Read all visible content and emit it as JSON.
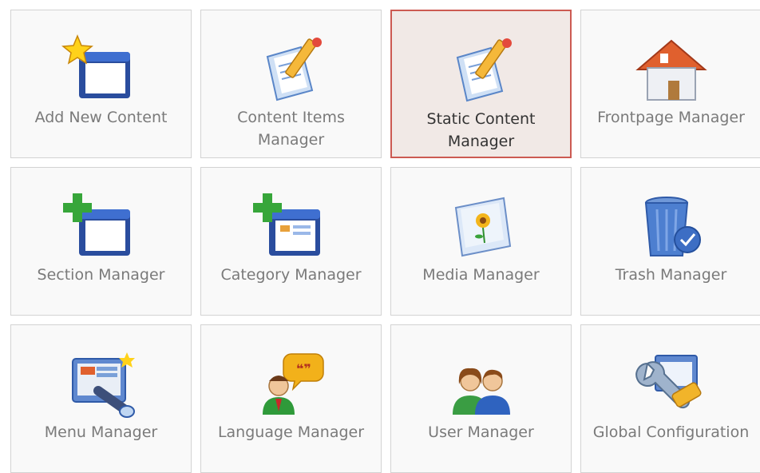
{
  "tiles": [
    {
      "label": "Add New Content",
      "icon": "add-content-icon"
    },
    {
      "label": "Content Items Manager",
      "icon": "content-items-icon"
    },
    {
      "label": "Static Content Manager",
      "icon": "static-content-icon",
      "active": true
    },
    {
      "label": "Frontpage Manager",
      "icon": "home-icon"
    },
    {
      "label": "Section Manager",
      "icon": "section-icon"
    },
    {
      "label": "Category Manager",
      "icon": "category-icon"
    },
    {
      "label": "Media Manager",
      "icon": "media-icon"
    },
    {
      "label": "Trash Manager",
      "icon": "trash-icon"
    },
    {
      "label": "Menu Manager",
      "icon": "menu-icon"
    },
    {
      "label": "Language Manager",
      "icon": "language-icon"
    },
    {
      "label": "User Manager",
      "icon": "users-icon"
    },
    {
      "label": "Global Configuration",
      "icon": "config-icon"
    }
  ],
  "colors": {
    "active_border": "#cc5a52",
    "active_bg": "#f1e9e6",
    "tile_border": "#d3d3d3",
    "tile_bg": "#f9f9f9"
  }
}
